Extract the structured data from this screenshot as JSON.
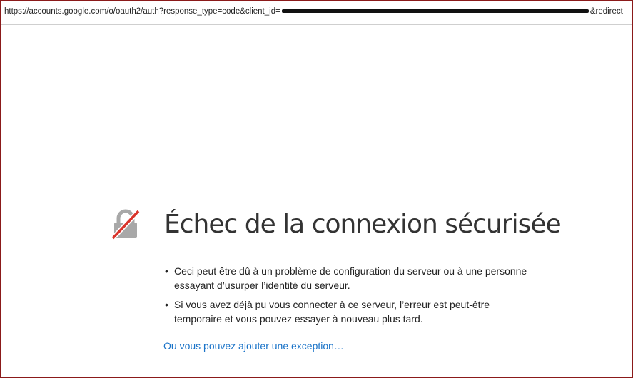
{
  "address_bar": {
    "url_prefix": "https://accounts.google.com/o/oauth2/auth?response_type=code&client_id=",
    "url_suffix": "&redirect"
  },
  "error_page": {
    "icon": "broken-lock-icon",
    "title": "Échec de la connexion sécurisée",
    "bullets": [
      "Ceci peut être dû à un problème de configuration du serveur ou à une personne essayant d’usurper l’identité du serveur.",
      "Si vous avez déjà pu vous connecter à ce serveur, l’erreur est peut-être temporaire et vous pouvez essayer à nouveau plus tard."
    ],
    "exception_link": "Ou vous pouvez ajouter une exception…"
  },
  "colors": {
    "link": "#1a73c8",
    "lock_strike": "#d9342b",
    "lock_body": "#a8a8a8",
    "frame_border": "#8b1a1a"
  }
}
